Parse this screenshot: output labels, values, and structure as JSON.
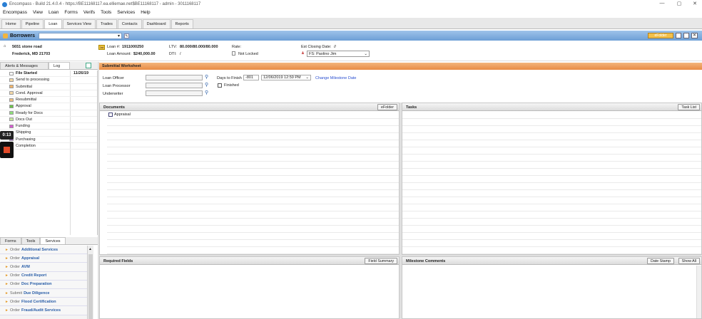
{
  "window": {
    "title": "Encompass - Build 21.4.0.4 - https://BE11168117.ea.elliemae.net$BE11168117 - admin - 3011168117",
    "min": "—",
    "max": "▢",
    "close": "✕"
  },
  "menu": [
    "Encompass",
    "View",
    "Loan",
    "Forms",
    "Verifs",
    "Tools",
    "Services",
    "Help"
  ],
  "tabs": [
    "Home",
    "Pipeline",
    "Loan",
    "Services View",
    "Trades",
    "Contacts",
    "Dashboard",
    "Reports"
  ],
  "active_tab": "Loan",
  "borrowers": {
    "label": "Borrowers",
    "selected": "",
    "efolder_btn": "eFolder"
  },
  "loan_header": {
    "address_line1": "5651 stone road",
    "address_line2": "Frederick, MD 21703",
    "loan_no_label": "Loan #:",
    "loan_no": "1911000250",
    "loan_amount_label": "Loan Amount:",
    "loan_amount": "$240,000.00",
    "ltv_label": "LTV:",
    "ltv": "80.000/80.000/80.000",
    "dti_label": "DTI:",
    "dti": "/",
    "rate_label": "Rate:",
    "lock_status": "Not Locked",
    "closing_label": "Est Closing Date:",
    "closing_date": "//",
    "assignee": "FS: Paolino Jim"
  },
  "left_tabs": [
    "Alerts & Messages",
    "Log"
  ],
  "active_left_tab": "Log",
  "log": [
    {
      "label": "File Started",
      "date": "11/26/19",
      "color": "#ffffff",
      "bold": true
    },
    {
      "label": "Send to processing",
      "date": "",
      "color": "#f5d9a8",
      "bold": false
    },
    {
      "label": "Submittal",
      "date": "",
      "color": "#f0b46a",
      "bold": false
    },
    {
      "label": "Cond. Approval",
      "date": "",
      "color": "#f5d9a8",
      "bold": false
    },
    {
      "label": "Resubmittal",
      "date": "",
      "color": "#f0c080",
      "bold": false
    },
    {
      "label": "Approval",
      "date": "",
      "color": "#6cc24a",
      "bold": false
    },
    {
      "label": "Ready for Docs",
      "date": "",
      "color": "#8ee07a",
      "bold": false
    },
    {
      "label": "Docs Out",
      "date": "",
      "color": "#c8e6a0",
      "bold": false
    },
    {
      "label": "Funding",
      "date": "",
      "color": "#d55bd1",
      "bold": false
    },
    {
      "label": "Shipping",
      "date": "",
      "color": "#e0a0e0",
      "bold": false
    },
    {
      "label": "Purchasing",
      "date": "",
      "color": "#b07ad8",
      "bold": false
    },
    {
      "label": "Completion",
      "date": "",
      "color": "#e0c0f0",
      "bold": false
    }
  ],
  "timer": "0:13",
  "service_tabs": [
    "Forms",
    "Tools",
    "Services"
  ],
  "active_service_tab": "Services",
  "services": [
    {
      "verb": "Order",
      "name": "Additional Services"
    },
    {
      "verb": "Order",
      "name": "Appraisal"
    },
    {
      "verb": "Order",
      "name": "AVM"
    },
    {
      "verb": "Order",
      "name": "Credit Report"
    },
    {
      "verb": "Order",
      "name": "Doc Preparation"
    },
    {
      "verb": "Submit",
      "name": "Due Diligence"
    },
    {
      "verb": "Order",
      "name": "Flood Certification"
    },
    {
      "verb": "Order",
      "name": "Fraud/Audit Services"
    }
  ],
  "worksheet": {
    "title": "Submittal Worksheet",
    "loan_officer_label": "Loan Officer",
    "loan_processor_label": "Loan Processor",
    "underwriter_label": "Underwriter",
    "days_to_finish_label": "Days to Finish",
    "days_to_finish": "-801",
    "date_value": "12/06/2019 12:59 PM",
    "finished_label": "Finished",
    "change_milestone_date": "Change Milestone Date"
  },
  "documents": {
    "title": "Documents",
    "button": "eFolder",
    "items": [
      "Appraisal"
    ]
  },
  "tasks": {
    "title": "Tasks",
    "button": "Task List"
  },
  "required_fields": {
    "title": "Required Fields",
    "button": "Field Summary"
  },
  "milestone_comments": {
    "title": "Milestone Comments",
    "date_stamp_button": "Date Stamp",
    "show_all_button": "Show All"
  }
}
